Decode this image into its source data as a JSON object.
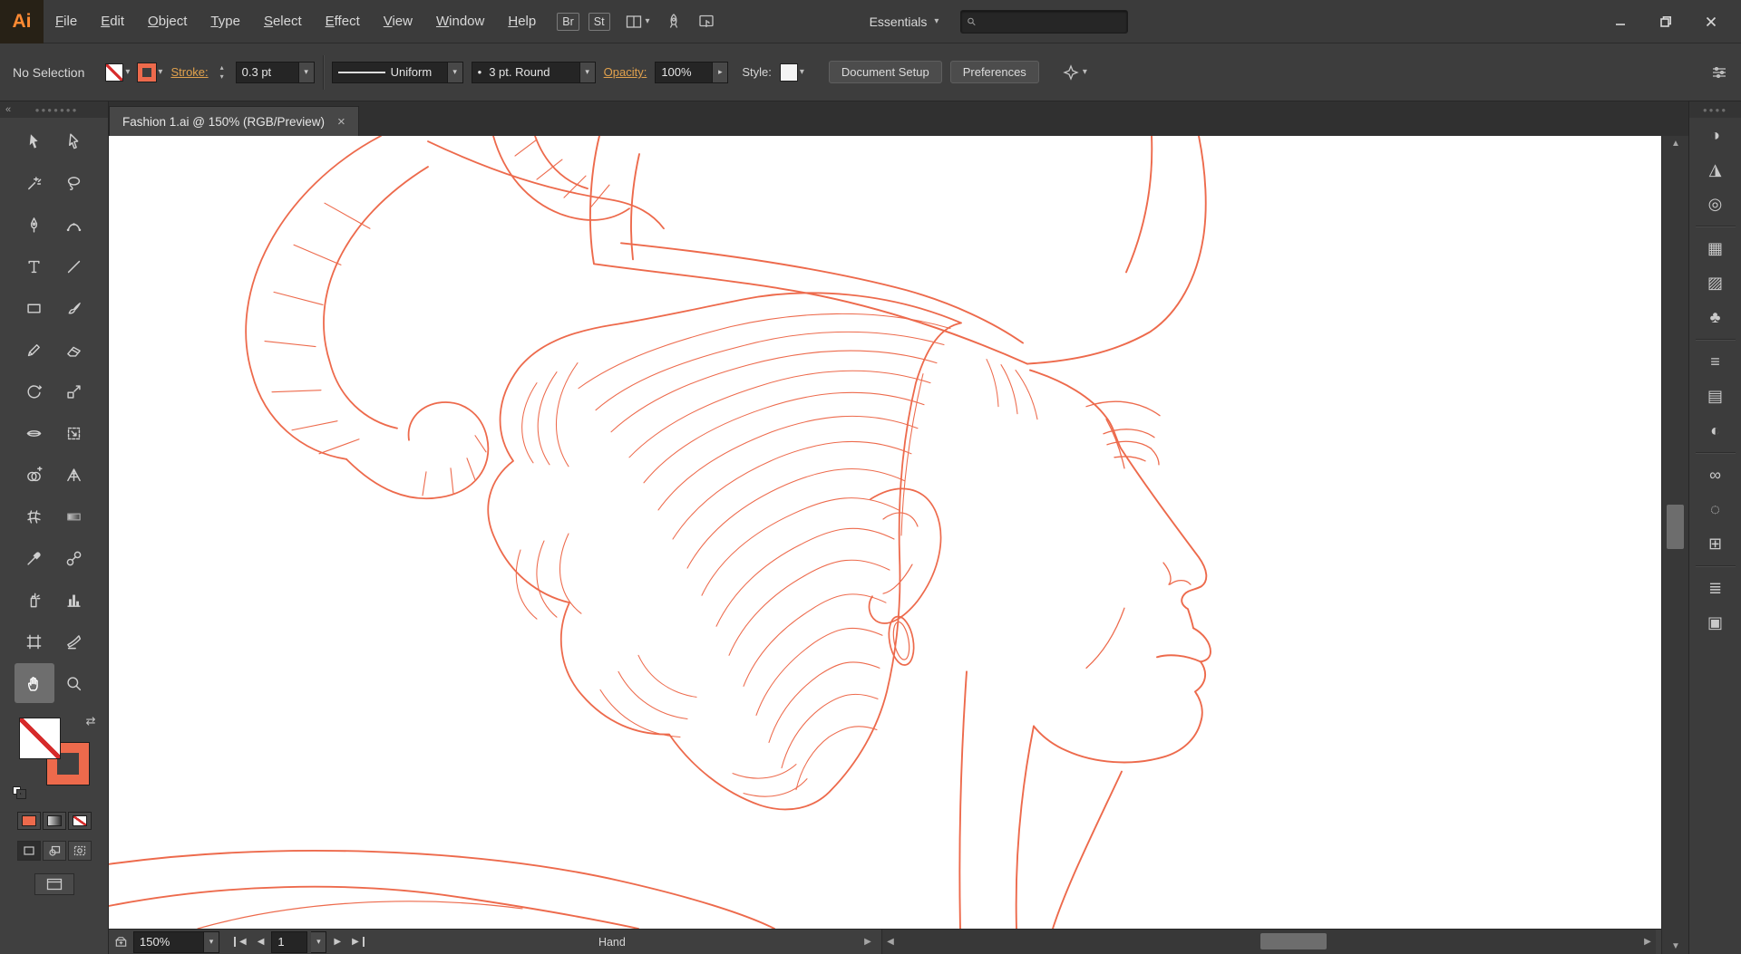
{
  "menubar": {
    "logo_text": "Ai",
    "menus": [
      {
        "label": "File"
      },
      {
        "label": "Edit"
      },
      {
        "label": "Object"
      },
      {
        "label": "Type"
      },
      {
        "label": "Select"
      },
      {
        "label": "Effect"
      },
      {
        "label": "View"
      },
      {
        "label": "Window"
      },
      {
        "label": "Help"
      }
    ],
    "bridge_label": "Br",
    "stock_label": "St",
    "workspace_switcher": "Essentials",
    "search_value": "",
    "icons": [
      "arrange-documents-icon",
      "gpu-performance-icon",
      "touch-workspace-icon",
      "search-icon",
      "minimize-icon",
      "restore-icon",
      "close-icon"
    ]
  },
  "controlbar": {
    "selection_status": "No Selection",
    "stroke_label": "Stroke:",
    "stroke_weight": "0.3 pt",
    "width_profile_label": "Uniform",
    "brush_bullet": "•",
    "brush_label": "3 pt. Round",
    "opacity_label": "Opacity:",
    "opacity_value": "100%",
    "style_label": "Style:",
    "document_setup_label": "Document Setup",
    "preferences_label": "Preferences"
  },
  "tabbar": {
    "title": "Fashion 1.ai @ 150% (RGB/Preview)",
    "close_glyph": "×"
  },
  "toolbar": {
    "active_tool": "hand-tool",
    "tools": [
      {
        "name": "selection-tool"
      },
      {
        "name": "direct-selection-tool"
      },
      {
        "name": "magic-wand-tool"
      },
      {
        "name": "lasso-tool"
      },
      {
        "name": "pen-tool"
      },
      {
        "name": "curvature-tool"
      },
      {
        "name": "type-tool"
      },
      {
        "name": "line-segment-tool"
      },
      {
        "name": "rectangle-tool"
      },
      {
        "name": "paintbrush-tool"
      },
      {
        "name": "pencil-tool"
      },
      {
        "name": "eraser-tool"
      },
      {
        "name": "rotate-tool"
      },
      {
        "name": "scale-tool"
      },
      {
        "name": "width-tool"
      },
      {
        "name": "free-transform-tool"
      },
      {
        "name": "shape-builder-tool"
      },
      {
        "name": "perspective-grid-tool"
      },
      {
        "name": "mesh-tool"
      },
      {
        "name": "gradient-tool"
      },
      {
        "name": "eyedropper-tool"
      },
      {
        "name": "blend-tool"
      },
      {
        "name": "symbol-sprayer-tool"
      },
      {
        "name": "column-graph-tool"
      },
      {
        "name": "artboard-tool"
      },
      {
        "name": "slice-tool"
      },
      {
        "name": "hand-tool"
      },
      {
        "name": "zoom-tool"
      }
    ]
  },
  "right_panel": {
    "icons": [
      {
        "name": "color-icon",
        "glyph": "◑"
      },
      {
        "name": "color-guide-icon",
        "glyph": "◮"
      },
      {
        "name": "recolor-artwork-icon",
        "glyph": "◎"
      },
      {
        "name": "swatches-icon",
        "glyph": "▦"
      },
      {
        "name": "brushes-icon",
        "glyph": "▨"
      },
      {
        "name": "symbols-icon",
        "glyph": "♣"
      },
      {
        "name": "stroke-icon",
        "glyph": "≡"
      },
      {
        "name": "gradient-icon",
        "glyph": "▤"
      },
      {
        "name": "transparency-icon",
        "glyph": "◐"
      },
      {
        "name": "libraries-icon",
        "glyph": "∞"
      },
      {
        "name": "appearance-icon",
        "glyph": "◌"
      },
      {
        "name": "transform-icon",
        "glyph": "⊞"
      },
      {
        "name": "layers-icon",
        "glyph": "≣"
      },
      {
        "name": "artboards-icon",
        "glyph": "▣"
      }
    ]
  },
  "statusbar": {
    "zoom_value": "150%",
    "artboard_value": "1",
    "status_label": "Hand"
  },
  "canvas": {
    "artwork_stroke_color": "#ED6A4C"
  },
  "colors": {
    "chrome": "#3D3D3D",
    "chrome_dark": "#262626",
    "text": "#D6D6D6",
    "accent_label_gold": "#E1A14D",
    "logo_orange": "#FF8A33",
    "artwork_stroke": "#ED6A4C",
    "canvas_white": "#FFFFFF"
  }
}
